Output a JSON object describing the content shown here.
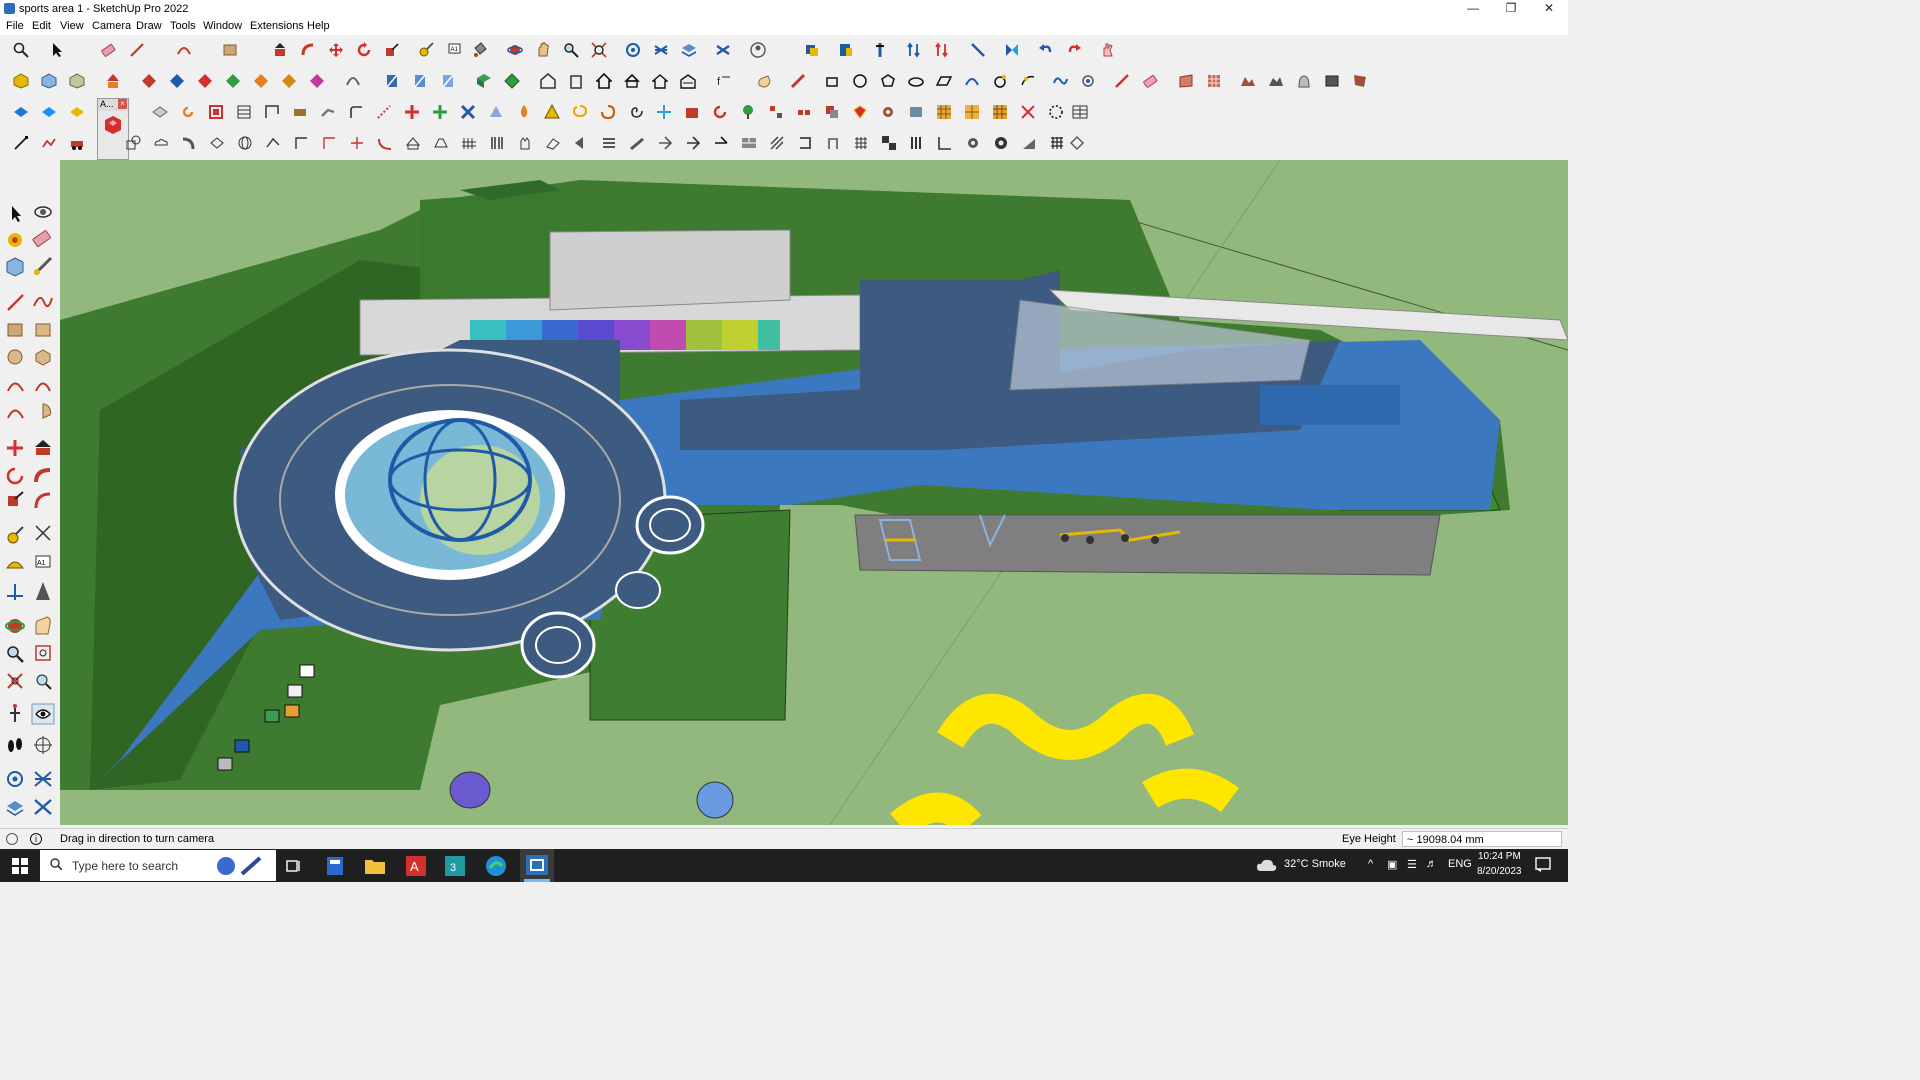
{
  "window": {
    "title": "sports area 1 - SketchUp Pro 2022",
    "controls": [
      "minimize-icon",
      "restore-icon",
      "close-icon"
    ]
  },
  "menu": [
    "File",
    "Edit",
    "View",
    "Camera",
    "Draw",
    "Tools",
    "Window",
    "Extensions",
    "Help"
  ],
  "toolbar": {
    "floating_tab_label": "A..."
  },
  "viewport": {
    "scene": "3D model of a sports area with running track, circular playground and fitness equipment"
  },
  "status": {
    "message": "Drag in direction to turn camera",
    "measure_label": "Eye Height",
    "measure_value": "~ 19098.04 mm"
  },
  "taskbar": {
    "search_placeholder": "Type here to search",
    "weather": "32°C  Smoke",
    "language": "ENG",
    "time": "10:24 PM",
    "date": "8/20/2023"
  },
  "colors": {
    "viewport_ground": "#93b87d",
    "track_blue": "#3f78b8",
    "track_dark": "#3d5a80",
    "lawn_green": "#3f7a2e",
    "accent_yellow": "#ffe600"
  }
}
